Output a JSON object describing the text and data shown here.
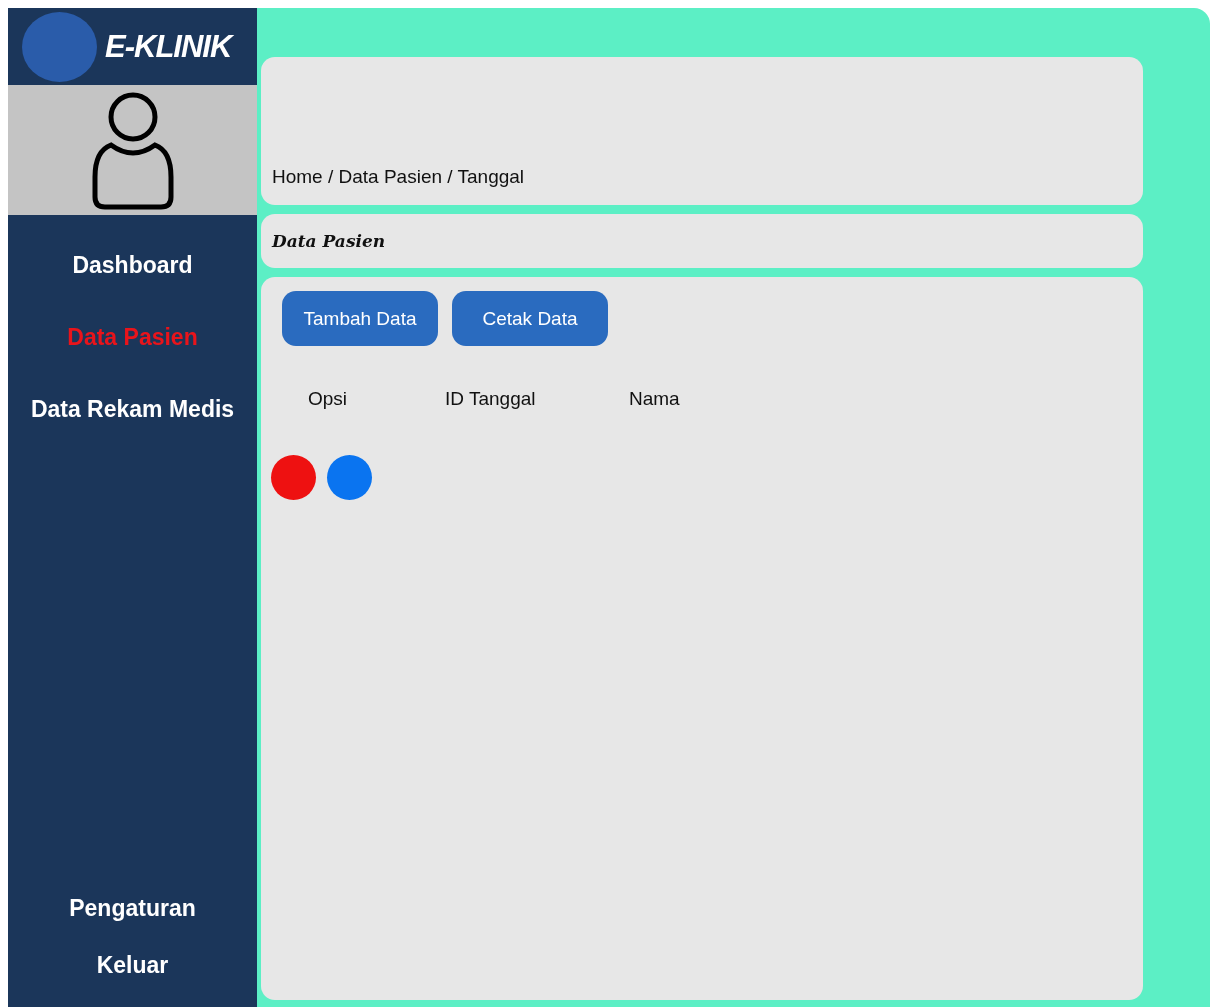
{
  "app": {
    "logo": "E-KLINIK"
  },
  "sidebar": {
    "items": [
      {
        "label": "Dashboard",
        "selected": false
      },
      {
        "label": "Data Pasien",
        "selected": true
      },
      {
        "label": "Data Rekam Medis",
        "selected": false
      }
    ],
    "bottom_items": [
      {
        "label": "Pengaturan"
      },
      {
        "label": "Keluar"
      }
    ]
  },
  "breadcrumb": "Home / Data Pasien / Tanggal",
  "section_title": "Data Pasien",
  "buttons": [
    "Tambah Data",
    "Cetak Data"
  ],
  "table": {
    "columns": [
      "Opsi",
      "ID Tanggal",
      "Nama"
    ],
    "rows": [
      {
        "actions": [
          {
            "color": "#ee1111"
          },
          {
            "color": "#0a74f0"
          }
        ]
      }
    ]
  }
}
